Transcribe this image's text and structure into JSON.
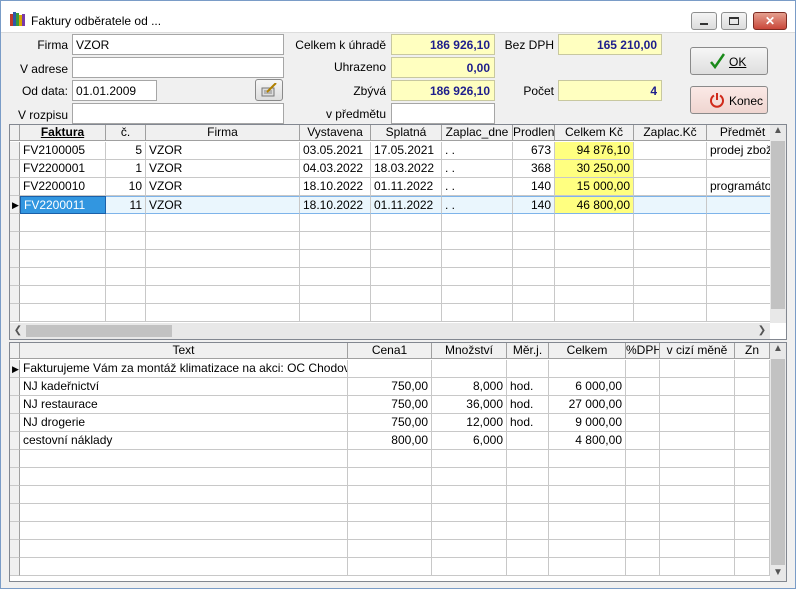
{
  "window": {
    "title": "Faktury odběratele od ..."
  },
  "form": {
    "firma_label": "Firma",
    "firma_value": "VZOR",
    "vadrese_label": "V adrese",
    "vadrese_value": "",
    "oddata_label": "Od data:",
    "oddata_value": "01.01.2009",
    "vrozpisu_label": "V rozpisu",
    "vrozpisu_value": "",
    "celkem_label": "Celkem k úhradě",
    "celkem_value": "186 926,10",
    "uhrazeno_label": "Uhrazeno",
    "uhrazeno_value": "0,00",
    "zbyva_label": "Zbývá",
    "zbyva_value": "186 926,10",
    "vpredmetu_label": "v předmětu",
    "vpredmetu_value": "",
    "bezdph_label": "Bez DPH",
    "bezdph_value": "165 210,00",
    "pocet_label": "Počet",
    "pocet_value": "4"
  },
  "buttons": {
    "ok": "OK",
    "konec": "Konec"
  },
  "invoices": {
    "columns": [
      "Faktura",
      "č.",
      "Firma",
      "Vystavena",
      "Splatná",
      "Zaplac_dne",
      "Prodlen",
      "Celkem Kč",
      "Zaplac.Kč",
      "Předmět"
    ],
    "rows": [
      {
        "faktura": "FV2100005",
        "c": "5",
        "firma": "VZOR",
        "vystavena": "03.05.2021",
        "splatna": "17.05.2021",
        "zaplac_dne": ". .",
        "prodlen": "673",
        "celkem": "94 876,10",
        "zaplac": "",
        "predmet": "prodej zboží"
      },
      {
        "faktura": "FV2200001",
        "c": "1",
        "firma": "VZOR",
        "vystavena": "04.03.2022",
        "splatna": "18.03.2022",
        "zaplac_dne": ". .",
        "prodlen": "368",
        "celkem": "30 250,00",
        "zaplac": "",
        "predmet": ""
      },
      {
        "faktura": "FV2200010",
        "c": "10",
        "firma": "VZOR",
        "vystavena": "18.10.2022",
        "splatna": "01.11.2022",
        "zaplac_dne": ". .",
        "prodlen": "140",
        "celkem": "15 000,00",
        "zaplac": "",
        "predmet": "programátorské"
      },
      {
        "faktura": "FV2200011",
        "c": "11",
        "firma": "VZOR",
        "vystavena": "18.10.2022",
        "splatna": "01.11.2022",
        "zaplac_dne": ". .",
        "prodlen": "140",
        "celkem": "46 800,00",
        "zaplac": "",
        "predmet": ""
      }
    ]
  },
  "items": {
    "columns": [
      "Text",
      "Cena1",
      "Množství",
      "Měr.j.",
      "Celkem",
      "%DPH",
      "v cizí měně",
      "Zn"
    ],
    "rows": [
      {
        "text": "Fakturujeme Vám za montáž klimatizace na akci: OC Chodov",
        "cena": "",
        "mnozstvi": "",
        "merj": "",
        "celkem": ""
      },
      {
        "text": "NJ kadeřnictví",
        "cena": "750,00",
        "mnozstvi": "8,000",
        "merj": "hod.",
        "celkem": "6 000,00"
      },
      {
        "text": "NJ restaurace",
        "cena": "750,00",
        "mnozstvi": "36,000",
        "merj": "hod.",
        "celkem": "27 000,00"
      },
      {
        "text": "NJ drogerie",
        "cena": "750,00",
        "mnozstvi": "12,000",
        "merj": "hod.",
        "celkem": "9 000,00"
      },
      {
        "text": "cestovní náklady",
        "cena": "800,00",
        "mnozstvi": "6,000",
        "merj": "",
        "celkem": "4 800,00"
      }
    ]
  }
}
